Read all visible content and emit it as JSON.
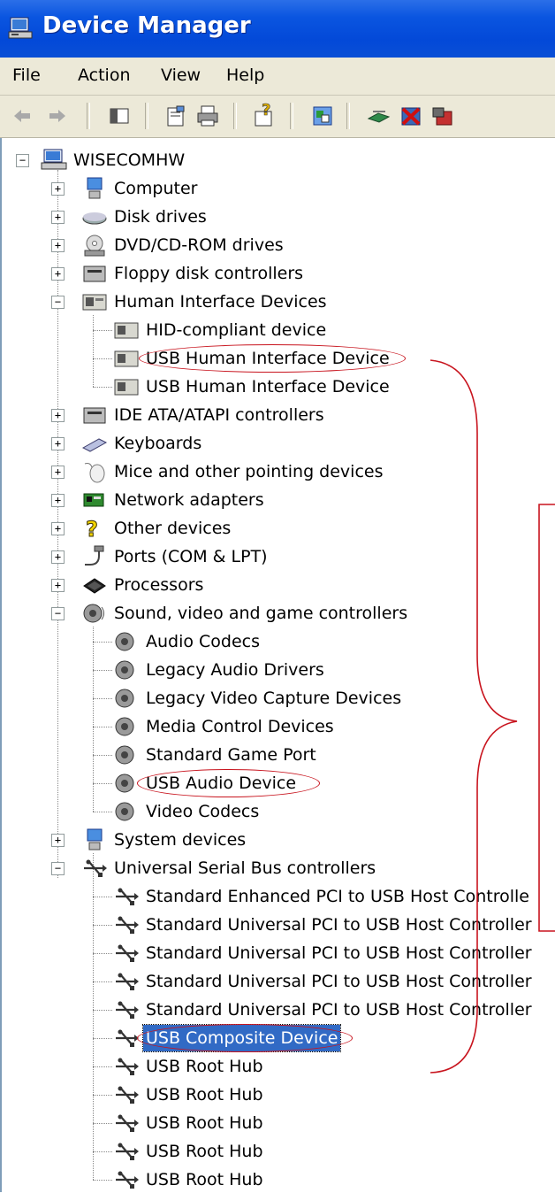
{
  "window": {
    "title": "Device Manager"
  },
  "menu": {
    "items": [
      "File",
      "Action",
      "View",
      "Help"
    ]
  },
  "toolbar": {
    "buttons": [
      "back-arrow-icon",
      "forward-arrow-icon",
      "show-hide-tree-icon",
      "properties-icon",
      "print-icon",
      "help-icon",
      "update-driver-icon",
      "scan-hardware-icon",
      "disable-device-icon",
      "uninstall-device-icon"
    ]
  },
  "tree": {
    "root": "WISECOMHW",
    "categories": [
      "Computer",
      "Disk drives",
      "DVD/CD-ROM drives",
      "Floppy disk controllers",
      "Human Interface Devices",
      "IDE ATA/ATAPI controllers",
      "Keyboards",
      "Mice and other pointing devices",
      "Network adapters",
      "Other devices",
      "Ports (COM & LPT)",
      "Processors",
      "Sound, video and game controllers",
      "System devices",
      "Universal Serial Bus controllers"
    ],
    "hid_children": [
      "HID-compliant device",
      "USB Human Interface Device",
      "USB Human Interface Device"
    ],
    "sound_children": [
      "Audio Codecs",
      "Legacy Audio Drivers",
      "Legacy Video Capture Devices",
      "Media Control Devices",
      "Standard Game Port",
      "USB Audio Device",
      "Video Codecs"
    ],
    "usb_children": [
      "Standard Enhanced PCI to USB Host Controlle",
      "Standard Universal PCI to USB Host Controller",
      "Standard Universal PCI to USB Host Controller",
      "Standard Universal PCI to USB Host Controller",
      "Standard Universal PCI to USB Host Controller",
      "USB Composite Device",
      "USB Root Hub",
      "USB Root Hub",
      "USB Root Hub",
      "USB Root Hub",
      "USB Root Hub"
    ],
    "selected": "USB Composite Device",
    "expander_plus": "+",
    "expander_minus": "−"
  },
  "colors": {
    "titlebar": "#0349d8",
    "selection": "#316ac5",
    "annotation": "#c8141e"
  }
}
